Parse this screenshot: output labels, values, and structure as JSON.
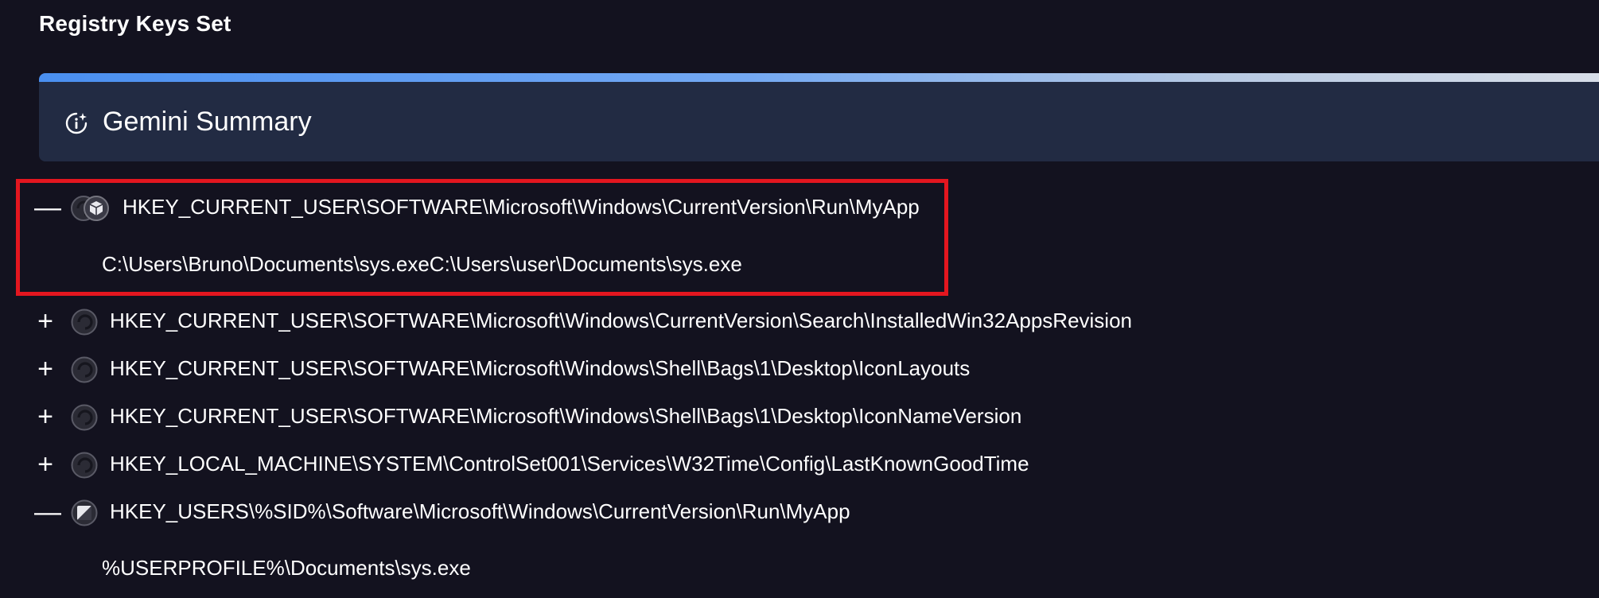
{
  "section": {
    "title": "Registry Keys Set"
  },
  "summary": {
    "label": "Gemini Summary",
    "icon": "ai-summary-icon",
    "gradient_colors": [
      "#4a8ff0",
      "#b7c9e3",
      "#d8dee8"
    ]
  },
  "entries": [
    {
      "toggle": "—",
      "expanded": true,
      "status_icon": "multi-engine-badge-icon",
      "key": "HKEY_CURRENT_USER\\SOFTWARE\\Microsoft\\Windows\\CurrentVersion\\Run\\MyApp",
      "value": "C:\\Users\\Bruno\\Documents\\sys.exeC:\\Users\\user\\Documents\\sys.exe",
      "highlighted": true
    },
    {
      "toggle": "+",
      "expanded": false,
      "status_icon": "sandbox-circle-icon",
      "key": "HKEY_CURRENT_USER\\SOFTWARE\\Microsoft\\Windows\\CurrentVersion\\Search\\InstalledWin32AppsRevision"
    },
    {
      "toggle": "+",
      "expanded": false,
      "status_icon": "sandbox-circle-icon",
      "key": "HKEY_CURRENT_USER\\SOFTWARE\\Microsoft\\Windows\\Shell\\Bags\\1\\Desktop\\IconLayouts"
    },
    {
      "toggle": "+",
      "expanded": false,
      "status_icon": "sandbox-circle-icon",
      "key": "HKEY_CURRENT_USER\\SOFTWARE\\Microsoft\\Windows\\Shell\\Bags\\1\\Desktop\\IconNameVersion"
    },
    {
      "toggle": "+",
      "expanded": false,
      "status_icon": "sandbox-circle-icon",
      "key": "HKEY_LOCAL_MACHINE\\SYSTEM\\ControlSet001\\Services\\W32Time\\Config\\LastKnownGoodTime"
    },
    {
      "toggle": "—",
      "expanded": true,
      "status_icon": "slash-square-icon",
      "key": "HKEY_USERS\\%SID%\\Software\\Microsoft\\Windows\\CurrentVersion\\Run\\MyApp",
      "value": "%USERPROFILE%\\Documents\\sys.exe"
    }
  ],
  "colors": {
    "background": "#13121f",
    "card": "#222b43",
    "highlight": "#e3161f",
    "text": "#ffffff"
  }
}
